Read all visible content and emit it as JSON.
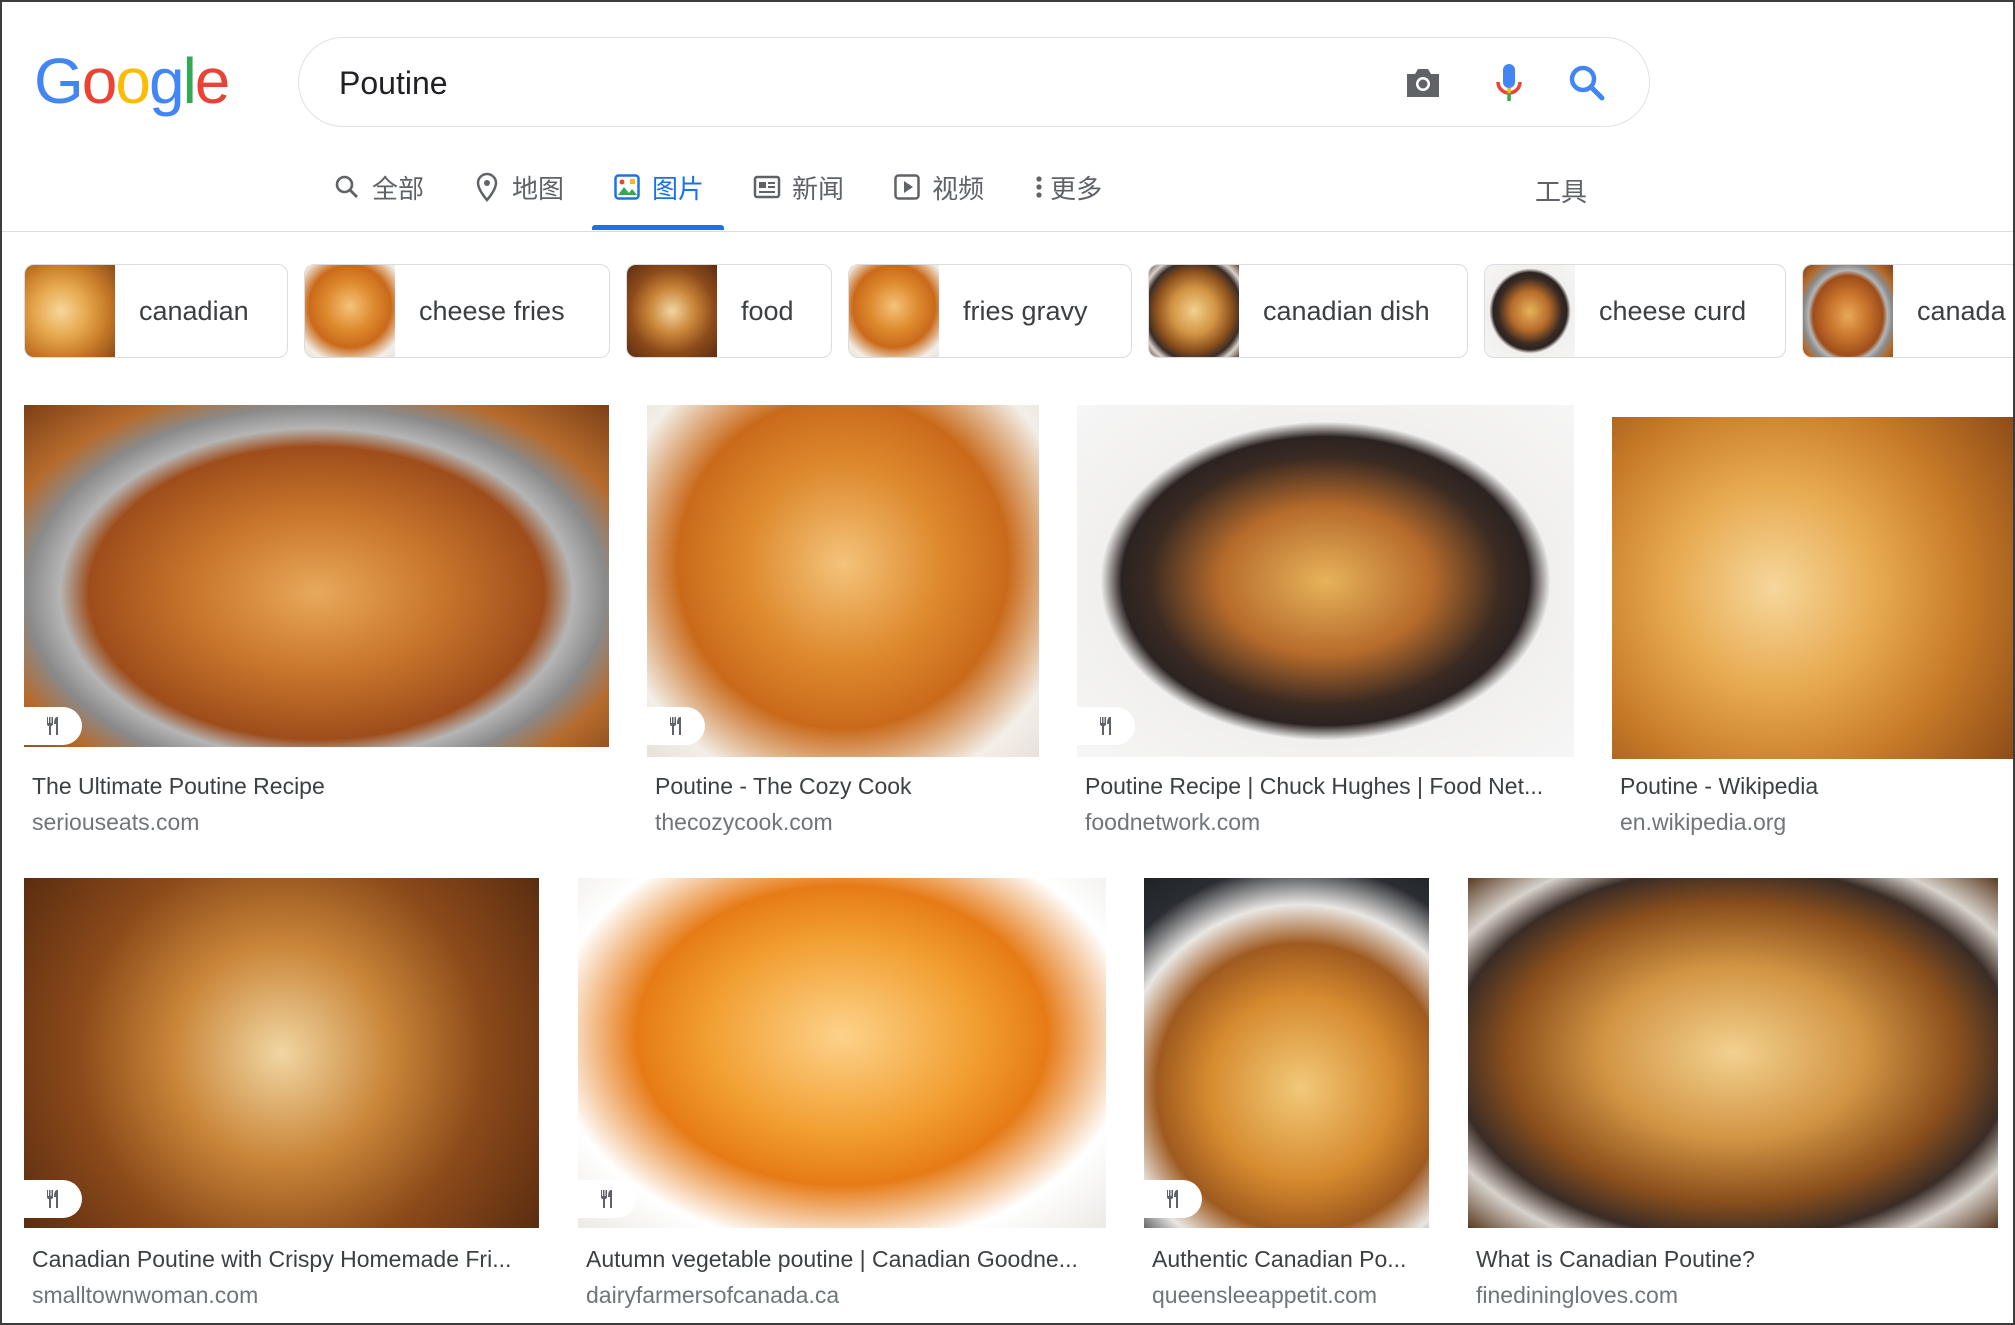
{
  "search": {
    "query": "Poutine"
  },
  "logo": {
    "letters": [
      "G",
      "o",
      "o",
      "g",
      "l",
      "e"
    ],
    "colors": [
      "#4285F4",
      "#EA4335",
      "#FBBC05",
      "#4285F4",
      "#34A853",
      "#EA4335"
    ]
  },
  "tabs": [
    {
      "label": "全部",
      "icon": "search-icon"
    },
    {
      "label": "地图",
      "icon": "map-pin-icon"
    },
    {
      "label": "图片",
      "icon": "image-icon",
      "active": true
    },
    {
      "label": "新闻",
      "icon": "news-icon"
    },
    {
      "label": "视频",
      "icon": "video-icon"
    },
    {
      "label": "更多",
      "icon": "more-vert-icon"
    }
  ],
  "tools_label": "工具",
  "chips": [
    {
      "label": "canadian"
    },
    {
      "label": "cheese fries"
    },
    {
      "label": "food"
    },
    {
      "label": "fries gravy"
    },
    {
      "label": "canadian dish"
    },
    {
      "label": "cheese curd"
    },
    {
      "label": "canada"
    }
  ],
  "results": [
    {
      "title": "The Ultimate Poutine Recipe",
      "source": "seriouseats.com",
      "badge": "recipe-icon"
    },
    {
      "title": "Poutine - The Cozy Cook",
      "source": "thecozycook.com",
      "badge": "recipe-icon"
    },
    {
      "title": "Poutine Recipe | Chuck Hughes | Food Net...",
      "source": "foodnetwork.com",
      "badge": "recipe-icon"
    },
    {
      "title": "Poutine - Wikipedia",
      "source": "en.wikipedia.org",
      "badge": ""
    },
    {
      "title": "Canadian Poutine with Crispy Homemade Fri...",
      "source": "smalltownwoman.com",
      "badge": "recipe-icon"
    },
    {
      "title": "Autumn vegetable poutine | Canadian Goodne...",
      "source": "dairyfarmersofcanada.ca",
      "badge": "recipe-icon"
    },
    {
      "title": "Authentic Canadian Po...",
      "source": "queensleeappetit.com",
      "badge": "recipe-icon"
    },
    {
      "title": "What is Canadian Poutine?",
      "source": "finediningloves.com",
      "badge": ""
    }
  ],
  "colors": {
    "accent": "#1a73e8",
    "text": "#3c4043",
    "muted": "#70757a"
  }
}
